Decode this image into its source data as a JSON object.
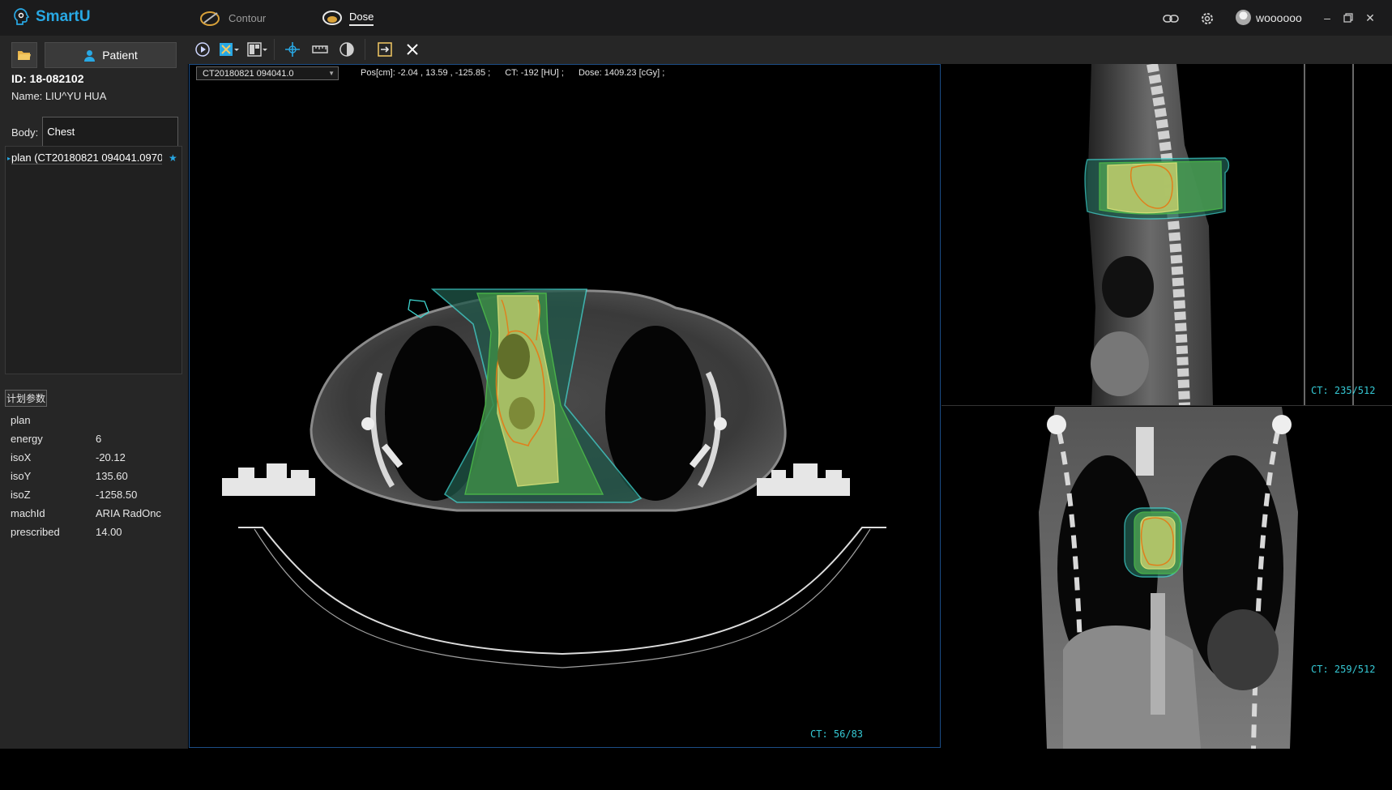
{
  "app": {
    "name": "SmartU"
  },
  "nav": {
    "contour": "Contour",
    "dose": "Dose"
  },
  "user": {
    "name": "woooooo"
  },
  "patient": {
    "button_label": "Patient",
    "id_text": "ID: 18-082102",
    "name_label": "Name:",
    "name_value": "LIU^YU HUA",
    "body_label": "Body:",
    "body_value": "Chest"
  },
  "plans": [
    {
      "label": "plan (CT20180821 094041.0970",
      "starred": true
    }
  ],
  "params": {
    "title": "计划参数",
    "rows": [
      {
        "key": "plan",
        "value": ""
      },
      {
        "key": "energy",
        "value": "6"
      },
      {
        "key": "isoX",
        "value": "-20.12"
      },
      {
        "key": "isoY",
        "value": "135.60"
      },
      {
        "key": "isoZ",
        "value": "-1258.50"
      },
      {
        "key": "machId",
        "value": "ARIA RadOnc"
      },
      {
        "key": "prescribed",
        "value": "14.00"
      }
    ]
  },
  "viewer": {
    "series": "CT20180821 094041.0",
    "pos": "Pos[cm]: -2.04 , 13.59 , -125.85 ;",
    "ct": "CT: -192 [HU] ;",
    "dose": "Dose: 1409.23 [cGy] ;",
    "axial_slice": "CT: 56/83",
    "sagittal_slice": "CT: 235/512",
    "coronal_slice": "CT: 259/512"
  },
  "colors": {
    "accent": "#28a8e4",
    "slice_label": "#35c9d5",
    "iso_cyan": "#3fd6d0",
    "iso_green": "#4fc24a",
    "iso_yellow": "#dfe47a",
    "iso_orange": "#e07f1c"
  }
}
